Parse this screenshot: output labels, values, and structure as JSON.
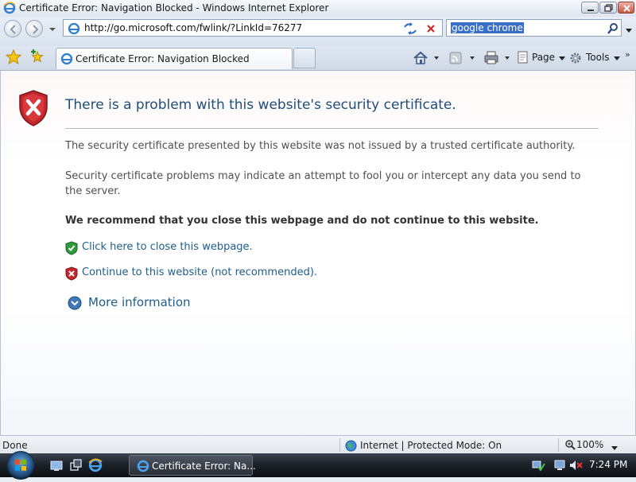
{
  "window": {
    "title": "Certificate Error: Navigation Blocked - Windows Internet Explorer"
  },
  "address_bar": {
    "url": "http://go.microsoft.com/fwlink/?LinkId=76277"
  },
  "search_bar": {
    "value": "google chrome"
  },
  "tab": {
    "label": "Certificate Error: Navigation Blocked"
  },
  "command_bar": {
    "page_label": "Page",
    "tools_label": "Tools"
  },
  "page": {
    "heading": "There is a problem with this website's security certificate.",
    "paragraph_1": "The security certificate presented by this website was not issued by a trusted certificate authority.",
    "paragraph_2": "Security certificate problems may indicate an attempt to fool you or intercept any data you send to the server.",
    "recommendation": "We recommend that you close this webpage and do not continue to this website.",
    "close_link": "Click here to close this webpage.",
    "continue_link": "Continue to this website (not recommended).",
    "more_info": "More information"
  },
  "status_bar": {
    "status": "Done",
    "zone": "Internet | Protected Mode: On",
    "zoom": "100%"
  },
  "taskbar": {
    "task_label": "Certificate Error: Na...",
    "clock": "7:24 PM"
  },
  "colors": {
    "link": "#1e5e8c",
    "heading": "#1f4e79",
    "error_red": "#c0282d",
    "safe_green": "#2f9a3a"
  },
  "icons": {
    "shield_error": "shield-x-icon",
    "shield_safe": "shield-check-icon",
    "expand": "chevron-down-circle-icon"
  }
}
